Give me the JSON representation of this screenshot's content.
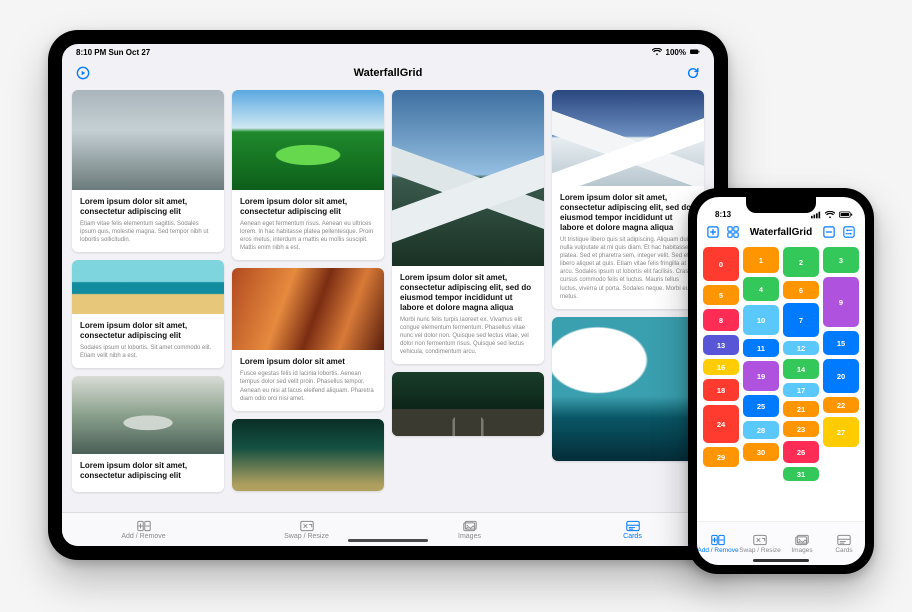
{
  "ipad": {
    "status": {
      "time_date": "8:10 PM  Sun Oct 27",
      "battery": "100%"
    },
    "nav": {
      "title": "WaterfallGrid"
    },
    "tabs": [
      {
        "label": "Add / Remove",
        "icon": "add-remove-icon"
      },
      {
        "label": "Swap / Resize",
        "icon": "swap-resize-icon"
      },
      {
        "label": "Images",
        "icon": "images-icon"
      },
      {
        "label": "Cards",
        "icon": "cards-icon"
      }
    ],
    "active_tab": 3,
    "columns": [
      [
        {
          "img": "mist",
          "title": "Lorem ipsum dolor sit amet, consectetur adipiscing elit",
          "body": "Etiam vitae felis elementum sagittis. Sodales ipsum quis, molestie magna. Sed tempor nibh ut lobortis sollicitudin."
        },
        {
          "img": "beach",
          "title": "Lorem ipsum dolor sit amet, consectetur adipiscing elit",
          "body": "Sodales ipsum ut lobortis. Sit amet commodo elit. Etiam velit nibh a est."
        },
        {
          "img": "river",
          "title": "Lorem ipsum dolor sit amet, consectetur adipiscing elit",
          "body": ""
        }
      ],
      [
        {
          "img": "green",
          "title": "Lorem ipsum dolor sit amet, consectetur adipiscing elit",
          "body": "Aenean eget fermentum risus. Aenean eu ultrices lorem. In hac habitasse platea pellentesque. Proin eros metus, interdum a mattis eu mollis suscipit. Mattis enim nibh a est."
        },
        {
          "img": "antelope",
          "title": "Lorem ipsum dolor sit amet",
          "body": "Fusce egestas felis id lacinia lobortis. Aenean tempus dolor sed velit proin. Phasellus tempor. Aenean eu nisi at lacus eleifend aliquam. Pharetra diam odio orci nisi amet."
        },
        {
          "img": "forest",
          "title": "",
          "body": ""
        }
      ],
      [
        {
          "img": "peak",
          "title": "Lorem ipsum dolor sit amet, consectetur adipiscing elit, sed do eiusmod tempor incididunt ut labore et dolore magna aliqua",
          "body": "Morbi nunc felis turpis laoreet ex. Vivamus elit congue elementum fermentum. Phasellus vitae nunc vel dolor non. Quisque sed lectus vitae, vel dolor non fermentum risus. Quisque sed lectus vehicula, condimentum arcu."
        },
        {
          "img": "rail",
          "title": "",
          "body": ""
        }
      ],
      [
        {
          "img": "snow",
          "title": "Lorem ipsum dolor sit amet, consectetur adipiscing elit, sed do eiusmod tempor incididunt ut labore et dolore magna aliqua",
          "body": "Ut tristique libero quis sit adipiscing. Aliquam dui nulla vulputate at mi quis diam. Et hac habitasse platea. Sed et pharetra sem, integer velit. Sed et libero aliquet at quis. Etiam vitae felis fringilla at arcu. Sodales ipsum ut lobortis elit facilisis. Cras cursus commodo felis et luctus. Mauris tellus luctus, viverra ut porta. Sodales neque. Morbi eu metus."
        },
        {
          "img": "ice",
          "title": "",
          "body": ""
        }
      ]
    ]
  },
  "iphone": {
    "status": {
      "time": "8:13"
    },
    "nav": {
      "title": "WaterfallGrid"
    },
    "tabs": [
      {
        "label": "Add / Remove"
      },
      {
        "label": "Swap / Resize"
      },
      {
        "label": "Images"
      },
      {
        "label": "Cards"
      }
    ],
    "active_tab": 0,
    "palette": {
      "red": "#ff3b30",
      "orange": "#ff9500",
      "yellow": "#ffcc00",
      "green": "#34c759",
      "teal": "#5ac8fa",
      "blue": "#007aff",
      "indigo": "#5856d6",
      "purple": "#af52de",
      "pink": "#ff2d55"
    },
    "tile_columns": [
      [
        {
          "n": 0,
          "c": "red",
          "h": 34
        },
        {
          "n": 5,
          "c": "orange",
          "h": 20
        },
        {
          "n": 8,
          "c": "pink",
          "h": 22
        },
        {
          "n": 13,
          "c": "indigo",
          "h": 20
        },
        {
          "n": 16,
          "c": "yellow",
          "h": 16
        },
        {
          "n": 18,
          "c": "red",
          "h": 22
        },
        {
          "n": 24,
          "c": "red",
          "h": 38
        },
        {
          "n": 29,
          "c": "orange",
          "h": 20
        }
      ],
      [
        {
          "n": 1,
          "c": "orange",
          "h": 26
        },
        {
          "n": 4,
          "c": "green",
          "h": 24
        },
        {
          "n": 10,
          "c": "teal",
          "h": 30
        },
        {
          "n": 11,
          "c": "blue",
          "h": 18
        },
        {
          "n": 19,
          "c": "purple",
          "h": 30
        },
        {
          "n": 25,
          "c": "blue",
          "h": 22
        },
        {
          "n": 28,
          "c": "teal",
          "h": 18
        },
        {
          "n": 30,
          "c": "orange",
          "h": 18
        }
      ],
      [
        {
          "n": 2,
          "c": "green",
          "h": 30
        },
        {
          "n": 6,
          "c": "orange",
          "h": 18
        },
        {
          "n": 7,
          "c": "blue",
          "h": 34
        },
        {
          "n": 12,
          "c": "teal",
          "h": 14
        },
        {
          "n": 14,
          "c": "green",
          "h": 20
        },
        {
          "n": 17,
          "c": "teal",
          "h": 14
        },
        {
          "n": 21,
          "c": "orange",
          "h": 16
        },
        {
          "n": 23,
          "c": "orange",
          "h": 16
        },
        {
          "n": 26,
          "c": "pink",
          "h": 22
        },
        {
          "n": 31,
          "c": "green",
          "h": 14
        }
      ],
      [
        {
          "n": 3,
          "c": "green",
          "h": 26
        },
        {
          "n": 9,
          "c": "purple",
          "h": 50
        },
        {
          "n": 15,
          "c": "blue",
          "h": 24
        },
        {
          "n": 20,
          "c": "blue",
          "h": 34
        },
        {
          "n": 22,
          "c": "orange",
          "h": 16
        },
        {
          "n": 27,
          "c": "yellow",
          "h": 30
        }
      ]
    ]
  }
}
